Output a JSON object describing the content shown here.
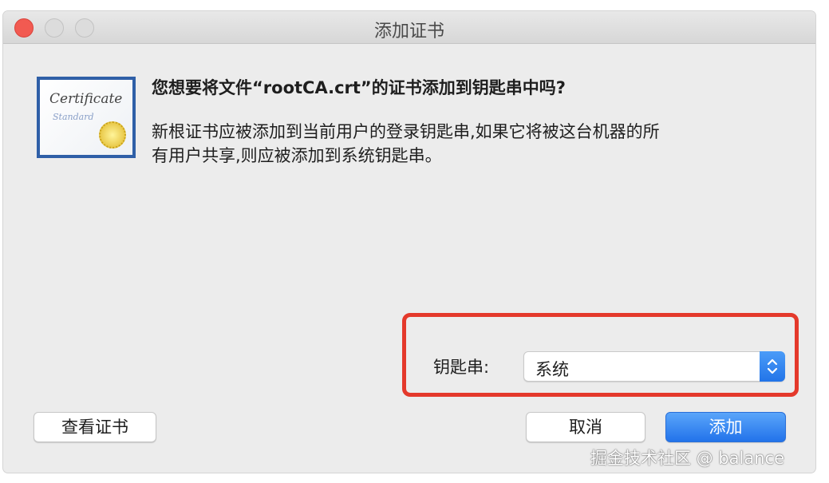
{
  "window": {
    "title": "添加证书"
  },
  "certificate_icon": {
    "line1": "Certificate",
    "line2": "Standard"
  },
  "dialog": {
    "heading": "您想要将文件“rootCA.crt”的证书添加到钥匙串中吗?",
    "body_line1": "新根证书应被添加到当前用户的登录钥匙串,如果它将被这台机器的所",
    "body_line2": "有用户共享,则应被添加到系统钥匙串。"
  },
  "keychain": {
    "label": "钥匙串:",
    "selected": "系统"
  },
  "buttons": {
    "view_certificate": "查看证书",
    "cancel": "取消",
    "add": "添加"
  },
  "watermark": "掘金技术社区 @ balance",
  "colors": {
    "accent": "#2a7bf0",
    "highlight_border": "#e4392b",
    "close_light": "#f25a51"
  }
}
